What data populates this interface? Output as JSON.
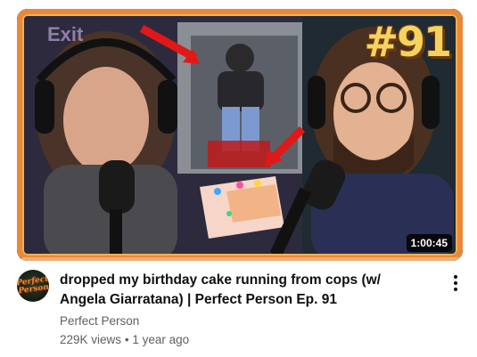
{
  "video": {
    "thumbnail": {
      "episode_badge": "#91",
      "background_sign": "Exit",
      "duration": "1:00:45",
      "watch_progress_fraction": 0.01
    },
    "title": "dropped my birthday cake running from cops (w/ Angela Giarratana) | Perfect Person Ep. 91",
    "channel": {
      "name": "Perfect Person",
      "avatar_text": "Perfect Person"
    },
    "views": "229K views",
    "separator": "•",
    "age": "1 year ago"
  },
  "icons": {
    "more_actions": "more-vert-icon"
  },
  "colors": {
    "thumbnail_border": "#e8893a",
    "badge": "#f4d35e",
    "title": "#0f0f0f",
    "meta": "#606060",
    "progress": "#ff0000"
  }
}
